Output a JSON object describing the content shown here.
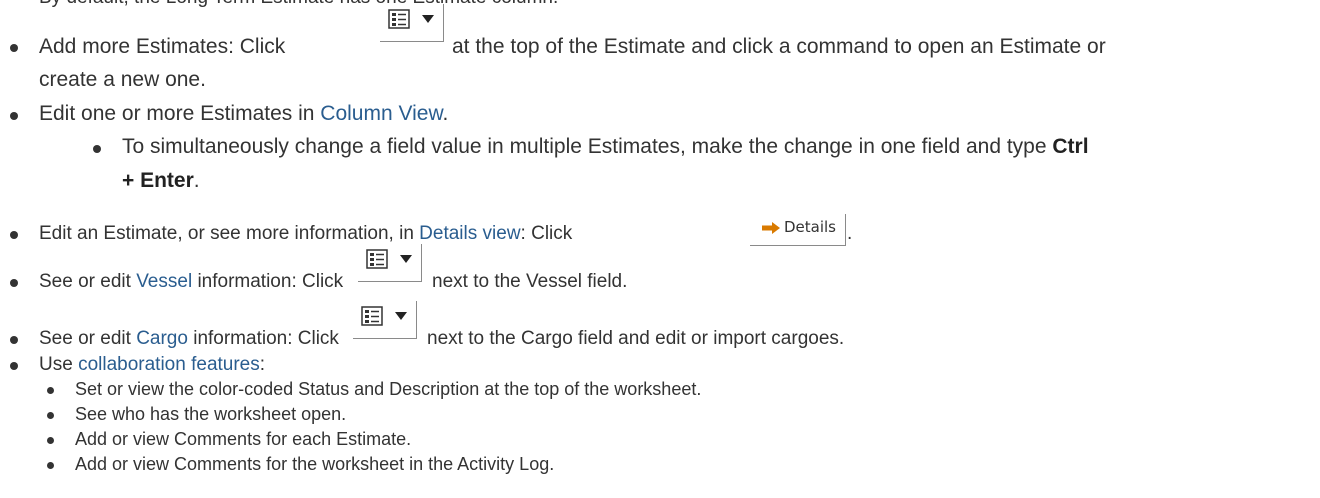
{
  "intro_fragment": "By default, the Long Term Estimate has one Estimate column.",
  "items": [
    {
      "text_before": "Add more Estimates: Click",
      "text_after": "at the top of the Estimate and click a command to open an Estimate or",
      "continuation": "create a new one."
    },
    {
      "text_before": "Edit one or more Estimates in",
      "link": "Column View",
      "text_after": "."
    },
    {
      "sub_text": "To simultaneously change a field value in multiple Estimates, make the change in one field and type",
      "sub_bold": "Ctrl",
      "sub_cont_bold": "+ Enter",
      "sub_cont_after": "."
    },
    {
      "text_before": "Edit an Estimate, or see more information, in",
      "link": "Details view",
      "text_mid": ": Click",
      "button_label": "Details",
      "text_after": "."
    },
    {
      "text_before": "See or edit",
      "link": "Vessel",
      "text_mid": "information: Click",
      "text_after": "next to the Vessel field."
    },
    {
      "text_before": "See or edit",
      "link": "Cargo",
      "text_mid": "information: Click",
      "text_after": "next to the Cargo field and edit or import cargoes."
    },
    {
      "text_before": "Use",
      "link": "collaboration features",
      "text_after": ":"
    }
  ],
  "collab_subitems": [
    "Set or view the color-coded Status and Description at the top of the worksheet.",
    "See who has the worksheet open.",
    "Add or view Comments for each Estimate.",
    "Add or view Comments for the worksheet in the Activity Log."
  ],
  "icons": [
    "list-menu-icon",
    "dropdown-caret-icon",
    "right-arrow-icon"
  ],
  "colors": {
    "text": "#333333",
    "link": "#2a5d8f",
    "icon_arrow": "#d97a00"
  }
}
